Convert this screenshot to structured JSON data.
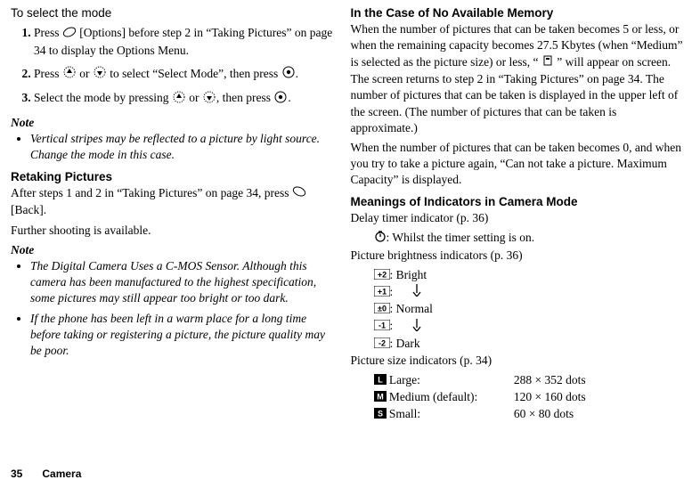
{
  "left": {
    "select_mode_heading": "To select the mode",
    "step1_a": "Press ",
    "step1_b": " [Options] before step 2 in “Taking Pictures” on page 34 to display the Options Menu.",
    "step2_a": "Press ",
    "step2_or": " or ",
    "step2_b": " to select “Select Mode”, then press ",
    "step2_c": ".",
    "step3_a": "Select the mode by pressing ",
    "step3_or": " or ",
    "step3_b": ", then press ",
    "step3_c": ".",
    "note_label": "Note",
    "note1": "Vertical stripes may be reflected to a picture by light source. Change the mode in this case.",
    "retake_heading": "Retaking Pictures",
    "retake_p1_a": "After steps 1 and 2 in “Taking Pictures” on page 34, press ",
    "retake_p1_b": " [Back].",
    "retake_p2": "Further shooting is available.",
    "note2_label": "Note",
    "note2a": "The Digital Camera Uses a C-MOS Sensor. Although this camera has been manufactured to the highest specification, some pictures may still appear too bright or too dark.",
    "note2b": "If the phone has been left in a warm place for a long time before taking or registering a picture, the picture quality may be poor."
  },
  "right": {
    "nomem_heading": "In the Case of No Available Memory",
    "nomem_p1_a": "When the number of pictures that can be taken becomes 5 or less, or when the remaining capacity becomes 27.5 Kbytes (when “Medium” is selected as the picture size) or less, “ ",
    "nomem_p1_b": " ” will appear on screen. The screen returns to step 2 in “Taking Pictures” on page 34. The number of pictures that can be taken is displayed in the upper left of the screen. (The number of pictures that can be taken is approximate.)",
    "nomem_p2": "When the number of pictures that can be taken becomes 0, and when you try to take a picture again, “Can not take a picture. Maximum Capacity” is displayed.",
    "ind_heading": "Meanings of Indicators in Camera Mode",
    "delay_line": "Delay timer indicator (p. 36)",
    "delay_desc": ": Whilst the timer setting is on.",
    "bright_line": "Picture brightness indicators (p. 36)",
    "bright_vals": {
      "p2": "+2",
      "p1": "+1",
      "z0": "±0",
      "m1": "-1",
      "m2": "-2"
    },
    "bright_labels": {
      "bright": ": Bright",
      "mid1": ":",
      "normal": ": Normal",
      "mid2": ":",
      "dark": ": Dark"
    },
    "size_line": "Picture size indicators (p. 34)",
    "size_codes": {
      "l": "L",
      "m": "M",
      "s": "S"
    },
    "sizes": {
      "large_name": "Large:",
      "large_val": "288 × 352 dots",
      "medium_name": "Medium (default):",
      "medium_val": "120 × 160 dots",
      "small_name": "Small:",
      "small_val": "60 × 80 dots"
    }
  },
  "footer": {
    "page": "35",
    "section": "Camera"
  }
}
